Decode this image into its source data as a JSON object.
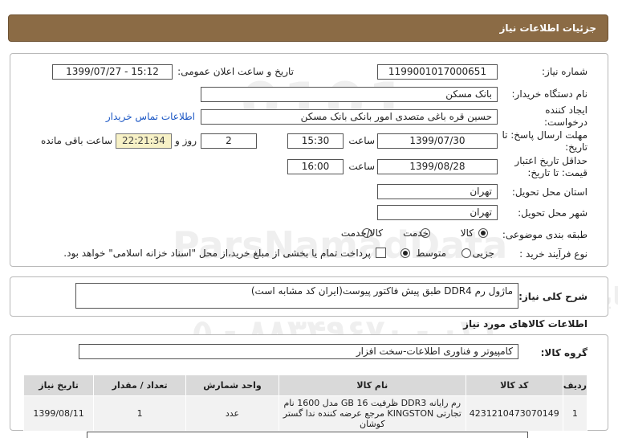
{
  "header": {
    "title": "جزئیات اطلاعات نیاز"
  },
  "watermarks": {
    "logo_text": "ParsNamadData",
    "number": "1",
    "org_text": "پایگاه اطلاع رسانی مناقصه و مزایده",
    "phone": "۰۲۱ - ۸۸۳۴۹۶۷۰ - ۵"
  },
  "form": {
    "need_number_label": "شماره نیاز:",
    "need_number": "1199001017000651",
    "announce_label": "تاریخ و ساعت اعلان عمومی:",
    "announce_value": "1399/07/27 - 15:12",
    "buyer_org_label": "نام دستگاه خریدار:",
    "buyer_org": "بانک مسکن",
    "creator_label": "ایجاد کننده درخواست:",
    "creator": "حسین  قره باغی متصدی امور بانکی بانک مسکن",
    "contact_link": "اطلاعات تماس خریدار",
    "deadline_label": "مهلت ارسال پاسخ: تا تاریخ:",
    "deadline_date": "1399/07/30",
    "time_label": "ساعت",
    "deadline_time": "15:30",
    "days_value": "2",
    "days_label": "روز و",
    "remaining_time": "22:21:34",
    "remaining_label": "ساعت باقی مانده",
    "validity_label": "حداقل تاریخ اعتبار قیمت: تا تاریخ:",
    "validity_date": "1399/08/28",
    "validity_time": "16:00",
    "province_label": "استان محل تحویل:",
    "province": "تهران",
    "city_label": "شهر محل تحویل:",
    "city": "تهران",
    "category_label": "طبقه بندی موضوعی:",
    "category_options": [
      "کالا",
      "خدمت",
      "کالا/خدمت"
    ],
    "category_selected": "کالا",
    "process_label": "نوع فرآیند خرید :",
    "process_options": [
      "جزیی",
      "متوسط"
    ],
    "process_selected": "متوسط",
    "payment_note": "پرداخت تمام یا بخشی از مبلغ خرید،از محل \"اسناد خزانه اسلامی\" خواهد بود."
  },
  "description": {
    "label": "شرح کلی نیاز:",
    "text": "ماژول رم DDR4 طبق پیش فاکتور پیوست(ایران کد مشابه است)"
  },
  "goods": {
    "section_title": "اطلاعات کالاهای مورد نیاز",
    "group_label": "گروه کالا:",
    "group_value": "کامپیوتر و فناوری اطلاعات-سخت افزار",
    "columns": [
      "ردیف",
      "کد کالا",
      "نام کالا",
      "واحد شمارش",
      "تعداد / مقدار",
      "تاریخ نیاز"
    ],
    "rows": [
      {
        "row": "1",
        "code": "4231210473070149",
        "name": "رم رایانه DDR3 ظرفیت GB 16 مدل 1600 نام تجارتی KINGSTON مرجع عرضه کننده ندا گستر کوشان",
        "unit": "عدد",
        "qty": "1",
        "date": "1399/08/11"
      }
    ]
  }
}
